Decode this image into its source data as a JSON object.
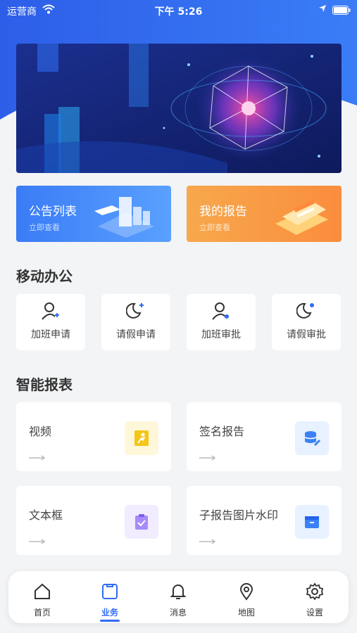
{
  "status_bar": {
    "carrier": "运营商",
    "time": "下午 5:26"
  },
  "cards": [
    {
      "title": "公告列表",
      "subtitle": "立即查看"
    },
    {
      "title": "我的报告",
      "subtitle": "立即查看"
    }
  ],
  "mobile_office": {
    "title": "移动办公",
    "items": [
      {
        "label": "加班申请",
        "icon": "user-plus-icon"
      },
      {
        "label": "请假申请",
        "icon": "moon-plus-icon"
      },
      {
        "label": "加班审批",
        "icon": "user-check-icon"
      },
      {
        "label": "请假审批",
        "icon": "moon-user-icon"
      }
    ]
  },
  "smart_reports": {
    "title": "智能报表",
    "items": [
      {
        "label": "视频",
        "icon": "runner-icon",
        "color": "#f5c518"
      },
      {
        "label": "签名报告",
        "icon": "database-edit-icon",
        "color": "#3b82f6"
      },
      {
        "label": "文本框",
        "icon": "clipboard-check-icon",
        "color": "#a78bfa"
      },
      {
        "label": "子报告图片水印",
        "icon": "box-icon",
        "color": "#3b82f6"
      }
    ]
  },
  "tabbar": {
    "items": [
      {
        "label": "首页",
        "icon": "home-icon"
      },
      {
        "label": "业务",
        "icon": "square-icon"
      },
      {
        "label": "消息",
        "icon": "bell-icon"
      },
      {
        "label": "地图",
        "icon": "map-pin-icon"
      },
      {
        "label": "设置",
        "icon": "gear-icon"
      }
    ],
    "active_index": 1
  },
  "colors": {
    "accent": "#2f6cf6",
    "notice_card": "#3a7cf6",
    "report_card": "#fa8d3d",
    "background": "#f3f4f6"
  }
}
